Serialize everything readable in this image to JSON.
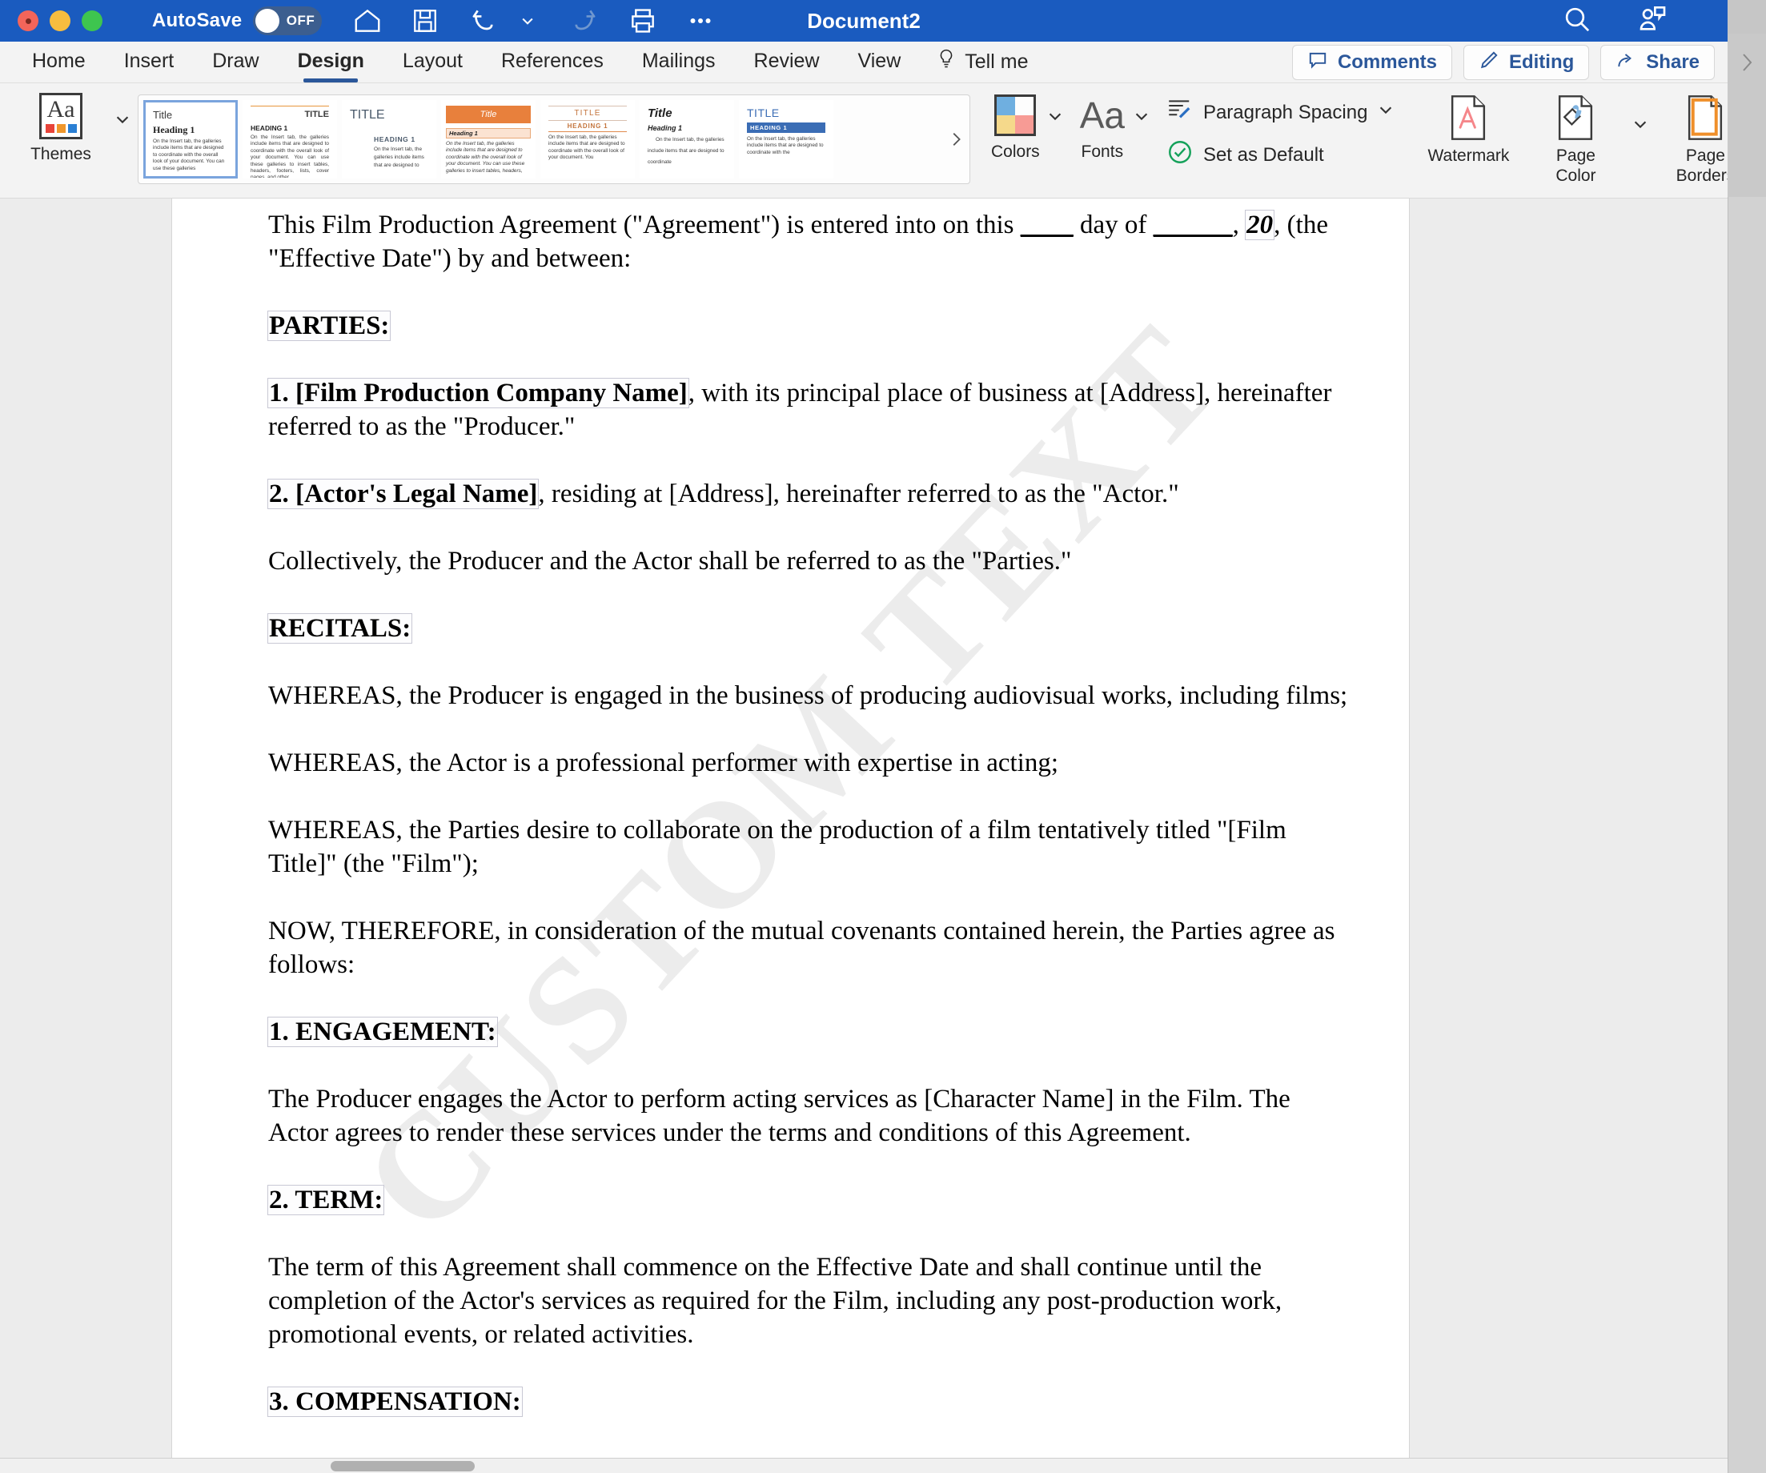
{
  "window": {
    "title": "Document2",
    "traffic_lights": [
      "close",
      "minimize",
      "maximize"
    ]
  },
  "quick_access": {
    "autosave_label": "AutoSave",
    "autosave_state": "OFF",
    "buttons": [
      {
        "name": "home-icon",
        "tooltip": "Home"
      },
      {
        "name": "save-icon",
        "tooltip": "Save"
      },
      {
        "name": "undo-icon",
        "tooltip": "Undo"
      },
      {
        "name": "undo-dropdown-chevron-icon",
        "tooltip": "Undo options"
      },
      {
        "name": "redo-icon",
        "tooltip": "Redo"
      },
      {
        "name": "print-icon",
        "tooltip": "Print"
      },
      {
        "name": "more-options-icon",
        "tooltip": "More"
      }
    ],
    "right_buttons": [
      {
        "name": "search-icon",
        "tooltip": "Search"
      },
      {
        "name": "account-chat-icon",
        "tooltip": "Account"
      }
    ]
  },
  "tabs": [
    {
      "label": "Home",
      "active": false
    },
    {
      "label": "Insert",
      "active": false
    },
    {
      "label": "Draw",
      "active": false
    },
    {
      "label": "Design",
      "active": true
    },
    {
      "label": "Layout",
      "active": false
    },
    {
      "label": "References",
      "active": false
    },
    {
      "label": "Mailings",
      "active": false
    },
    {
      "label": "Review",
      "active": false
    },
    {
      "label": "View",
      "active": false
    }
  ],
  "tell_me": {
    "label": "Tell me",
    "icon": "lightbulb-icon"
  },
  "tab_actions": [
    {
      "label": "Comments",
      "icon": "comment-icon"
    },
    {
      "label": "Editing",
      "icon": "pencil-icon"
    },
    {
      "label": "Share",
      "icon": "share-icon"
    }
  ],
  "ribbon": {
    "themes": {
      "label": "Themes",
      "icon_text": "Aa",
      "swatches": [
        "#e8443a",
        "#f0972c",
        "#2a7fd4"
      ],
      "dropdown_icon": "chevron-down-icon"
    },
    "style_gallery": {
      "next_icon": "chevron-right-icon",
      "items": [
        {
          "id": "style-1",
          "selected": true,
          "title": "Title",
          "heading": "Heading 1",
          "body": "On the Insert tab, the galleries include items that are designed to coordinate with the overall look of your document. You can use these galleries",
          "accent": "#2b579a"
        },
        {
          "id": "style-2",
          "selected": false,
          "title": "TITLE",
          "heading": "HEADING 1",
          "body": "On the Insert tab, the galleries include items that are designed to coordinate with the overall look of your document. You can use these galleries to insert tables, headers, footers, lists, cover pages, and other",
          "accent": "#e8963c"
        },
        {
          "id": "style-3",
          "selected": false,
          "title": "TITLE",
          "heading": "HEADING 1",
          "body": "On the Insert tab, the galleries include items that are designed to",
          "accent": "#4b5a6b"
        },
        {
          "id": "style-4",
          "selected": false,
          "title": "Title",
          "heading": "Heading 1",
          "body": "On the Insert tab, the galleries include items that are designed to coordinate with the overall look of your document. You can use these galleries to insert tables, headers,",
          "accent": "#e8803c"
        },
        {
          "id": "style-5",
          "selected": false,
          "title": "TITLE",
          "heading": "HEADING 1",
          "body": "On the Insert tab, the galleries include items that are designed to coordinate with the overall look of your document. You",
          "accent": "#e08a4e"
        },
        {
          "id": "style-6",
          "selected": false,
          "title": "Title",
          "heading": "Heading 1",
          "body": "On the Insert tab, the galleries include items that are designed to coordinate",
          "accent": "#333333"
        },
        {
          "id": "style-7",
          "selected": false,
          "title": "TITLE",
          "heading": "HEADING 1",
          "body": "On the Insert tab, the galleries include items that are designed to coordinate with the",
          "accent": "#3b6db5"
        }
      ]
    },
    "colors": {
      "label": "Colors",
      "quadrants": [
        "#6fafe0",
        "#fdfdfd",
        "#f5d98b",
        "#f79b95"
      ],
      "dropdown_icon": "chevron-down-icon"
    },
    "fonts": {
      "label": "Fonts",
      "icon_text": "Aa",
      "dropdown_icon": "chevron-down-icon"
    },
    "paragraph_spacing": {
      "label": "Paragraph Spacing",
      "icon": "paragraph-spacing-icon",
      "dropdown_icon": "chevron-down-icon"
    },
    "set_as_default": {
      "label": "Set as Default",
      "icon": "check-circle-icon",
      "icon_color": "#15a15a"
    },
    "watermark": {
      "label": "Watermark",
      "icon": "watermark-page-icon"
    },
    "page_color": {
      "label": "Page\nColor",
      "label_line1": "Page",
      "label_line2": "Color",
      "icon": "paint-bucket-page-icon",
      "dropdown_icon": "chevron-down-icon"
    },
    "page_borders": {
      "label_line1": "Page",
      "label_line2": "Borders",
      "icon": "page-border-icon",
      "border_color": "#ef8f2a"
    }
  },
  "document": {
    "watermark_text": "CUSTOM TEXT",
    "paragraphs": [
      {
        "id": "p-intro",
        "type": "mixed",
        "runs": [
          {
            "text": "This Film Production Agreement (\"Agreement\") is entered into on this ",
            "style": "plain"
          },
          {
            "text": "____",
            "style": "underline"
          },
          {
            "text": " day of ",
            "style": "plain"
          },
          {
            "text": "______",
            "style": "underline"
          },
          {
            "text": ", ",
            "style": "plain"
          },
          {
            "text": "20",
            "style": "cc-bold-italic"
          },
          {
            "text": ", (the \"Effective Date\") by and between:",
            "style": "plain"
          }
        ]
      },
      {
        "id": "p-parties-heading",
        "type": "heading-cc",
        "text": "PARTIES:"
      },
      {
        "id": "p-party-1",
        "type": "mixed",
        "runs": [
          {
            "text": "1. [Film Production Company Name]",
            "style": "cc-bold"
          },
          {
            "text": ", with its principal place of business at [Address], hereinafter referred to as the \"Producer.\"",
            "style": "plain"
          }
        ]
      },
      {
        "id": "p-party-2",
        "type": "mixed",
        "runs": [
          {
            "text": "2. [Actor's Legal Name]",
            "style": "cc-bold"
          },
          {
            "text": ", residing at [Address], hereinafter referred to as the \"Actor.\"",
            "style": "plain"
          }
        ]
      },
      {
        "id": "p-collectively",
        "type": "plain",
        "text": "Collectively, the Producer and the Actor shall be referred to as the \"Parties.\""
      },
      {
        "id": "p-recitals-heading",
        "type": "heading-cc",
        "text": "RECITALS:"
      },
      {
        "id": "p-whereas-1",
        "type": "plain",
        "text": "WHEREAS, the Producer is engaged in the business of producing audiovisual works, including films;"
      },
      {
        "id": "p-whereas-2",
        "type": "plain",
        "text": "WHEREAS, the Actor is a professional performer with expertise in acting;"
      },
      {
        "id": "p-whereas-3",
        "type": "plain",
        "text": "WHEREAS, the Parties desire to collaborate on the production of a film tentatively titled \"[Film Title]\" (the \"Film\");"
      },
      {
        "id": "p-now-therefore",
        "type": "plain",
        "text": "NOW, THEREFORE, in consideration of the mutual covenants contained herein, the Parties agree as follows:"
      },
      {
        "id": "p-engagement-heading",
        "type": "heading-cc",
        "text": "1. ENGAGEMENT:"
      },
      {
        "id": "p-engagement-body",
        "type": "plain",
        "text": "The Producer engages the Actor to perform acting services as [Character Name] in the Film. The Actor agrees to render these services under the terms and conditions of this Agreement."
      },
      {
        "id": "p-term-heading",
        "type": "heading-cc",
        "text": "2. TERM:"
      },
      {
        "id": "p-term-body",
        "type": "plain",
        "text": "The term of this Agreement shall commence on the Effective Date and shall continue until the completion of the Actor's services as required for the Film, including any post-production work, promotional events, or related activities."
      },
      {
        "id": "p-compensation-heading",
        "type": "heading-cc",
        "text": "3. COMPENSATION:"
      }
    ]
  },
  "scrollbars": {
    "horizontal_thumb_visible": true,
    "right_panel_chevron": "chevron-right-icon"
  },
  "colors": {
    "titlebar": "#1a5bbf",
    "ribbon_bg": "#f3f3f3",
    "accent_blue": "#2b579a",
    "doc_bg": "#e9e9e9",
    "watermark_gray": "#ececec"
  }
}
